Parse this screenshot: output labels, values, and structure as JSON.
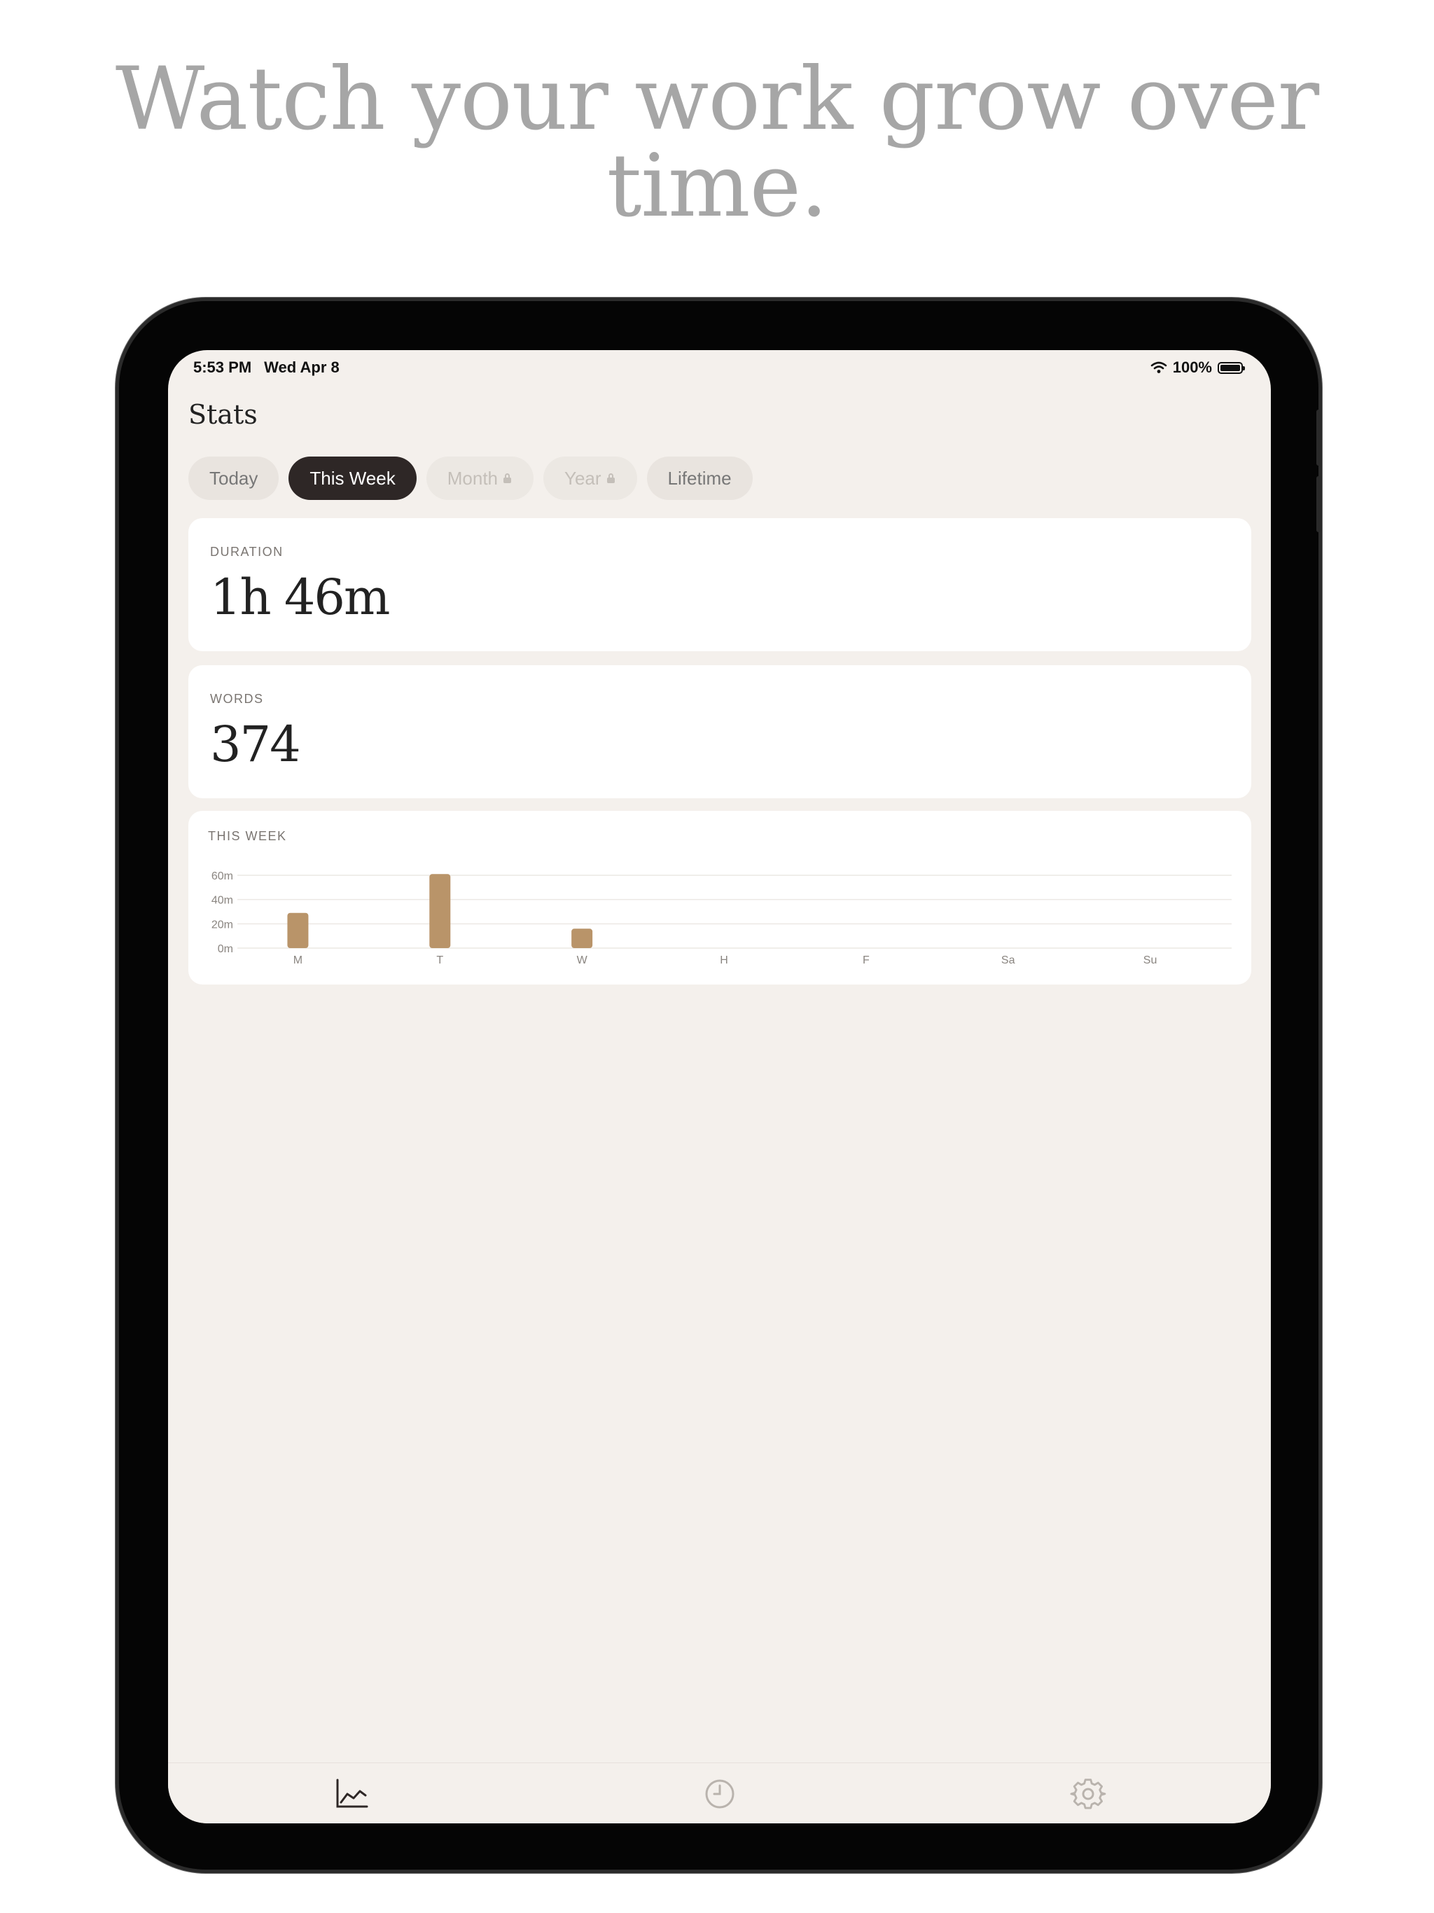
{
  "headline": {
    "line1": "Watch your work grow over",
    "line2": "time."
  },
  "status_bar": {
    "time": "5:53 PM",
    "date": "Wed Apr 8",
    "battery": "100%",
    "wifi_icon": "wifi-icon",
    "battery_icon": "battery-icon"
  },
  "page": {
    "title": "Stats"
  },
  "segments": [
    {
      "label": "Today",
      "state": "normal"
    },
    {
      "label": "This Week",
      "state": "active"
    },
    {
      "label": "Month",
      "state": "locked"
    },
    {
      "label": "Year",
      "state": "locked"
    },
    {
      "label": "Lifetime",
      "state": "normal"
    }
  ],
  "duration": {
    "label": "DURATION",
    "value": "1h 46m"
  },
  "words": {
    "label": "WORDS",
    "value": "374"
  },
  "chart_data": {
    "type": "bar",
    "title": "THIS WEEK",
    "categories": [
      "M",
      "T",
      "W",
      "H",
      "F",
      "Sa",
      "Su"
    ],
    "values": [
      29,
      61,
      16,
      0,
      0,
      0,
      0
    ],
    "ylim": [
      0,
      60
    ],
    "yticks": [
      0,
      20,
      40,
      60
    ],
    "ytick_labels": [
      "0m",
      "20m",
      "40m",
      "60m"
    ],
    "grid": true,
    "bar_color": "#b99469"
  },
  "tabs": [
    {
      "icon": "chart-line-icon",
      "state": "active"
    },
    {
      "icon": "clock-icon",
      "state": "inactive"
    },
    {
      "icon": "gear-icon",
      "state": "inactive"
    }
  ],
  "colors": {
    "background": "#f4f0ec",
    "card": "#ffffff",
    "active_segment": "#2e2726",
    "accent": "#b99469"
  }
}
